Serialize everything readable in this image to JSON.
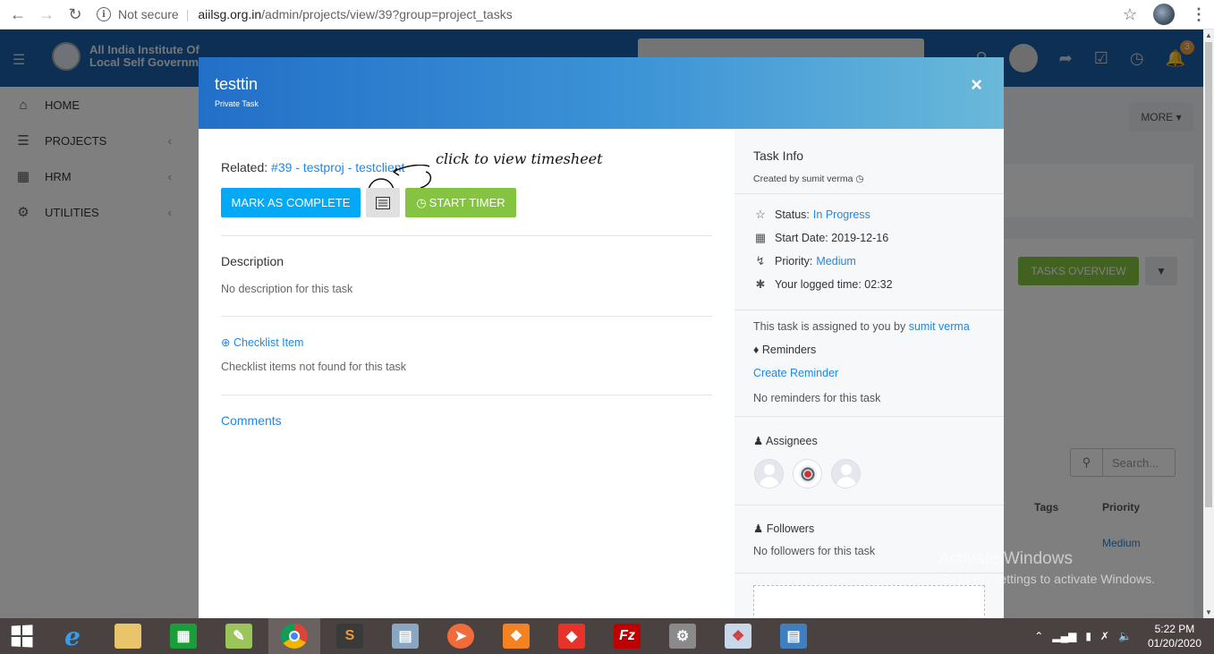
{
  "browser": {
    "not_secure": "Not secure",
    "url_domain": "aiilsg.org.in",
    "url_path": "/admin/projects/view/39?group=project_tasks"
  },
  "app": {
    "title_line1": "All India Institute Of",
    "title_line2": "Local Self Governm",
    "search_placeholder": "Search...",
    "notification_count": "3",
    "sidebar": [
      {
        "label": "HOME",
        "icon": "home-icon"
      },
      {
        "label": "PROJECTS",
        "icon": "bars-icon"
      },
      {
        "label": "HRM",
        "icon": "calculator-icon"
      },
      {
        "label": "UTILITIES",
        "icon": "cogs-icon"
      }
    ],
    "more_label": "MORE",
    "tasks_overview_label": "TASKS OVERVIEW",
    "table_search_placeholder": "Search...",
    "col_tags": "Tags",
    "col_priority": "Priority",
    "row_priority": "Medium"
  },
  "modal": {
    "title": "testtin",
    "subtitle": "Private Task",
    "close": "×",
    "related_label": "Related:",
    "related_link": "#39 - testproj - testclient",
    "annotation": "click to view timesheet",
    "mark_complete": "MARK AS COMPLETE",
    "start_timer": "START TIMER",
    "description_title": "Description",
    "description_text": "No description for this task",
    "checklist_link": "Checklist Item",
    "checklist_text": "Checklist items not found for this task",
    "comments": "Comments",
    "info": {
      "title": "Task Info",
      "created_by": "Created by sumit verma",
      "status_label": "Status:",
      "status_value": "In Progress",
      "start_date": "Start Date: 2019-12-16",
      "priority_label": "Priority:",
      "priority_value": "Medium",
      "logged_time": "Your logged time: 02:32",
      "assigned_text": "This task is assigned to you by",
      "assigned_by": "sumit verma",
      "reminders": "Reminders",
      "create_reminder": "Create Reminder",
      "no_reminders": "No reminders for this task",
      "assignees": "Assignees",
      "followers": "Followers",
      "no_followers": "No followers for this task"
    }
  },
  "watermark": {
    "line1": "Activate Windows",
    "line2": "Go to PC settings to activate Windows."
  },
  "taskbar": {
    "time": "5:22 PM",
    "date": "01/20/2020"
  }
}
